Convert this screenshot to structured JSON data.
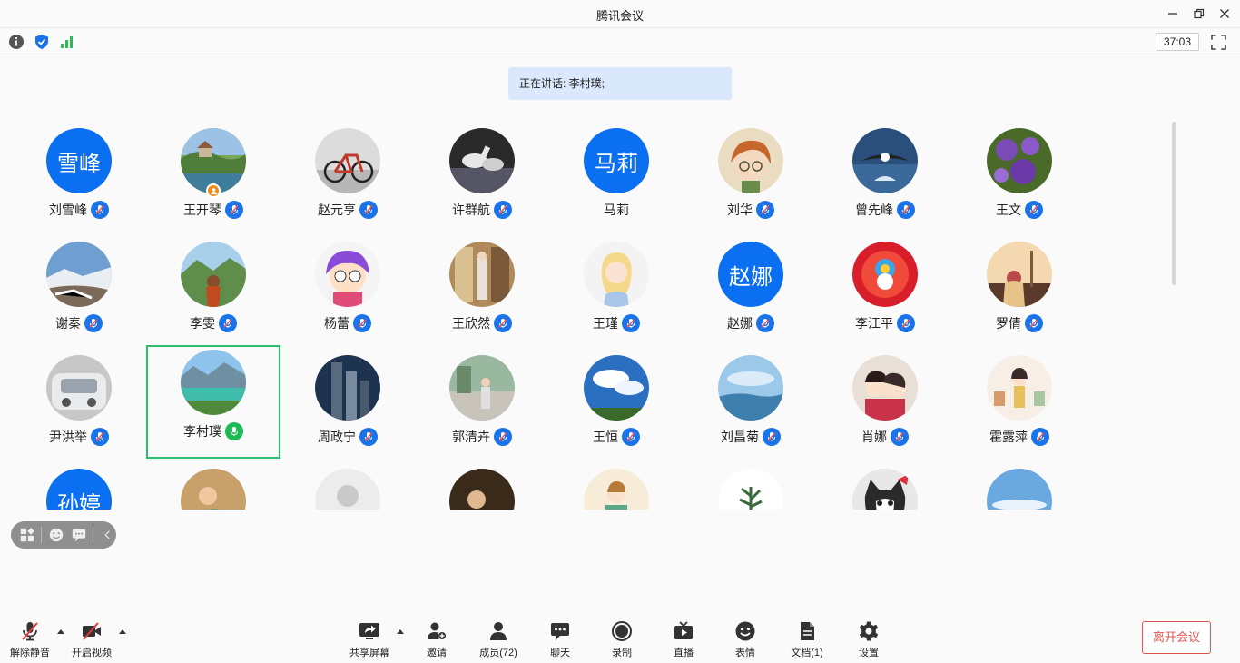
{
  "window": {
    "title": "腾讯会议"
  },
  "infobar": {
    "timer": "37:03"
  },
  "speaking": {
    "text": "正在讲话: 李村璞;"
  },
  "participants": [
    {
      "name": "刘雪峰",
      "avatar_text": "雪峰",
      "avatar_type": "text",
      "mic": "muted"
    },
    {
      "name": "王开琴",
      "avatar_type": "photo-landscape",
      "mic": "muted",
      "host": true
    },
    {
      "name": "赵元亨",
      "avatar_type": "photo-bicycle",
      "mic": "muted"
    },
    {
      "name": "许群航",
      "avatar_type": "photo-horses",
      "mic": "muted"
    },
    {
      "name": "马莉",
      "avatar_text": "马莉",
      "avatar_type": "text",
      "mic": "none"
    },
    {
      "name": "刘华",
      "avatar_type": "cartoon-girl",
      "mic": "muted"
    },
    {
      "name": "曾先峰",
      "avatar_type": "photo-eagle",
      "mic": "muted"
    },
    {
      "name": "王文",
      "avatar_type": "photo-flowers",
      "mic": "muted"
    },
    {
      "name": "谢秦",
      "avatar_type": "photo-snow",
      "mic": "muted"
    },
    {
      "name": "李雯",
      "avatar_type": "photo-mountain-girl",
      "mic": "muted"
    },
    {
      "name": "杨蕾",
      "avatar_type": "cartoon-purple",
      "mic": "muted"
    },
    {
      "name": "王欣然",
      "avatar_type": "photo-shop",
      "mic": "muted"
    },
    {
      "name": "王瑾",
      "avatar_type": "cartoon-princess",
      "mic": "muted"
    },
    {
      "name": "赵娜",
      "avatar_text": "赵娜",
      "avatar_type": "text",
      "mic": "muted"
    },
    {
      "name": "李江平",
      "avatar_type": "cartoon-sunburst",
      "mic": "muted"
    },
    {
      "name": "罗倩",
      "avatar_type": "photo-sunset",
      "mic": "muted"
    },
    {
      "name": "尹洪举",
      "avatar_type": "photo-car-snow",
      "mic": "muted"
    },
    {
      "name": "李村璞",
      "avatar_type": "photo-lake",
      "mic": "speaking",
      "selected": true
    },
    {
      "name": "周政宁",
      "avatar_type": "photo-towers",
      "mic": "muted"
    },
    {
      "name": "郭清卉",
      "avatar_type": "photo-street",
      "mic": "muted"
    },
    {
      "name": "王恒",
      "avatar_type": "photo-sky",
      "mic": "muted"
    },
    {
      "name": "刘昌菊",
      "avatar_type": "photo-sea",
      "mic": "muted"
    },
    {
      "name": "肖娜",
      "avatar_type": "cartoon-kids",
      "mic": "muted"
    },
    {
      "name": "霍露萍",
      "avatar_type": "cartoon-girl-shop",
      "mic": "muted"
    },
    {
      "name": "",
      "avatar_text": "孙婷",
      "avatar_type": "text",
      "mic": "none"
    },
    {
      "name": "",
      "avatar_type": "painting",
      "mic": "none"
    },
    {
      "name": "",
      "avatar_type": "default",
      "mic": "none"
    },
    {
      "name": "",
      "avatar_type": "painting-dark",
      "mic": "none"
    },
    {
      "name": "",
      "avatar_type": "cartoon-reading",
      "mic": "none"
    },
    {
      "name": "",
      "avatar_type": "plant",
      "mic": "none"
    },
    {
      "name": "",
      "avatar_type": "cat",
      "mic": "none"
    },
    {
      "name": "",
      "avatar_type": "photo-sky2",
      "mic": "none"
    }
  ],
  "toolbar": {
    "unmute": "解除静音",
    "start_video": "开启视频",
    "share_screen": "共享屏幕",
    "invite": "邀请",
    "members": "成员(72)",
    "chat": "聊天",
    "record": "录制",
    "live": "直播",
    "emoji": "表情",
    "docs": "文档(1)",
    "settings": "设置",
    "leave": "离开会议"
  },
  "colors": {
    "accent": "#1a73e8",
    "speaking": "#1db954",
    "leave": "#e2544f",
    "banner": "#d9e9fb"
  }
}
